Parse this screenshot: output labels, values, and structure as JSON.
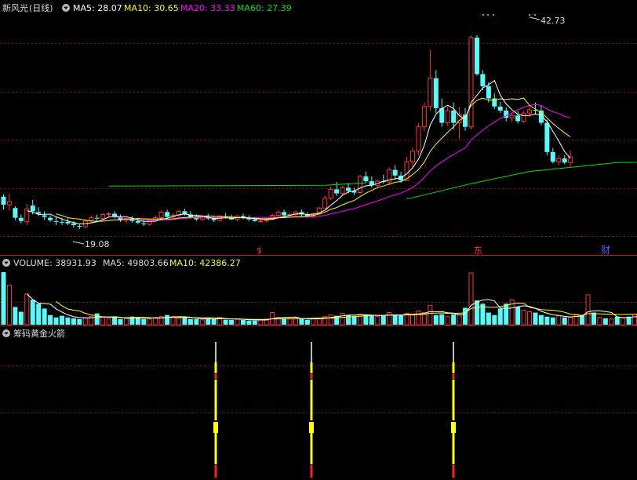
{
  "stock": {
    "name": "新风光",
    "period": "(日线)"
  },
  "colors": {
    "background": "#000000",
    "up": "#ff3333",
    "down": "#54fcfc",
    "ma5": "#ffffff",
    "ma10": "#ffff00",
    "ma20": "#ff00ff",
    "ma60": "#00e000",
    "grid": "#7a1010",
    "divider": "#c01818",
    "rocket_body": "#ffff00",
    "rocket_tip": "#ffffff",
    "rocket_mark": "#ff2020"
  },
  "main_header": {
    "ma5_label": "MA5: 28.07",
    "ma10_label": "MA10: 30.65",
    "ma20_label": "MA20: 33.33",
    "ma60_label": "MA60: 27.39"
  },
  "volume_header": {
    "title": "VOLUME: 38931.93",
    "ma5_label": "MA5: 49803.66",
    "ma10_label": "MA10: 42386.27"
  },
  "indicator_header": {
    "title": "筹码黄金火箭"
  },
  "price_annotations": {
    "high": "42.73",
    "low": "19.08"
  },
  "event_markers": [
    "$",
    "东",
    "财"
  ],
  "chart_data": [
    {
      "type": "candlestick",
      "panel": "price",
      "ylim": [
        16.4,
        45
      ],
      "high_label": "42.73",
      "low_label": "19.08",
      "candles": [
        [
          22.9,
          23.2,
          21.3,
          21.9
        ],
        [
          21.9,
          23.3,
          21.2,
          22.3
        ],
        [
          21.5,
          21.7,
          20.0,
          20.3
        ],
        [
          20.3,
          20.7,
          19.6,
          19.9
        ],
        [
          19.8,
          22.0,
          19.4,
          21.4
        ],
        [
          21.8,
          22.5,
          20.7,
          21.1
        ],
        [
          21.0,
          21.6,
          20.5,
          20.8
        ],
        [
          20.6,
          21.1,
          20.0,
          20.4
        ],
        [
          20.3,
          20.6,
          19.8,
          20.0
        ],
        [
          19.9,
          20.4,
          19.4,
          19.8
        ],
        [
          19.8,
          20.3,
          19.4,
          19.7
        ],
        [
          19.8,
          20.2,
          19.4,
          19.6
        ],
        [
          19.6,
          19.9,
          19.1,
          19.4
        ],
        [
          19.3,
          19.6,
          18.9,
          19.2
        ],
        [
          19.2,
          20.1,
          19.0,
          19.9
        ],
        [
          19.9,
          20.6,
          19.6,
          20.3
        ],
        [
          20.3,
          20.7,
          19.9,
          20.2
        ],
        [
          20.2,
          20.9,
          20.0,
          20.7
        ],
        [
          20.7,
          21.0,
          20.3,
          20.8
        ],
        [
          20.8,
          21.1,
          20.2,
          20.4
        ],
        [
          20.4,
          20.7,
          19.8,
          20.0
        ],
        [
          20.0,
          20.4,
          19.6,
          20.2
        ],
        [
          20.1,
          20.5,
          19.7,
          19.9
        ],
        [
          19.9,
          20.3,
          19.5,
          19.7
        ],
        [
          19.6,
          20.0,
          19.3,
          19.5
        ],
        [
          19.5,
          20.2,
          19.3,
          20.0
        ],
        [
          20.0,
          20.6,
          19.8,
          20.3
        ],
        [
          20.3,
          21.2,
          20.1,
          21.0
        ],
        [
          21.0,
          21.3,
          20.3,
          20.4
        ],
        [
          20.4,
          20.9,
          20.2,
          20.6
        ],
        [
          20.6,
          21.3,
          20.4,
          21.1
        ],
        [
          21.1,
          21.4,
          20.6,
          20.7
        ],
        [
          20.7,
          21.1,
          20.2,
          20.4
        ],
        [
          20.4,
          20.7,
          19.9,
          20.1
        ],
        [
          20.1,
          20.6,
          19.9,
          20.4
        ],
        [
          20.4,
          20.8,
          20.0,
          20.2
        ],
        [
          20.2,
          20.5,
          19.8,
          20.0
        ],
        [
          20.0,
          20.6,
          19.8,
          20.5
        ],
        [
          20.5,
          20.9,
          20.2,
          20.4
        ],
        [
          20.4,
          20.7,
          20.0,
          20.1
        ],
        [
          20.1,
          20.6,
          19.9,
          20.5
        ],
        [
          20.5,
          20.8,
          20.1,
          20.3
        ],
        [
          20.3,
          20.6,
          19.9,
          20.1
        ],
        [
          20.1,
          20.4,
          19.8,
          19.9
        ],
        [
          19.9,
          20.2,
          19.7,
          19.9
        ],
        [
          19.9,
          20.3,
          19.7,
          20.1
        ],
        [
          20.1,
          20.8,
          20.0,
          20.6
        ],
        [
          20.6,
          21.2,
          20.4,
          21.0
        ],
        [
          21.0,
          21.3,
          20.5,
          20.6
        ],
        [
          20.6,
          20.9,
          20.3,
          20.7
        ],
        [
          20.7,
          21.2,
          20.4,
          21.0
        ],
        [
          21.0,
          21.3,
          20.5,
          20.7
        ],
        [
          20.7,
          21.0,
          20.3,
          20.5
        ],
        [
          20.5,
          20.9,
          20.3,
          20.8
        ],
        [
          20.8,
          21.7,
          20.7,
          21.5
        ],
        [
          21.5,
          23.0,
          21.4,
          22.7
        ],
        [
          22.7,
          24.2,
          22.5,
          23.8
        ],
        [
          23.8,
          24.7,
          23.0,
          23.3
        ],
        [
          23.3,
          24.2,
          23.0,
          24.0
        ],
        [
          24.0,
          24.6,
          23.3,
          23.6
        ],
        [
          23.6,
          24.0,
          23.1,
          23.4
        ],
        [
          23.4,
          25.6,
          23.2,
          25.4
        ],
        [
          25.4,
          26.0,
          24.6,
          24.8
        ],
        [
          24.8,
          25.4,
          24.0,
          24.3
        ],
        [
          24.3,
          25.0,
          24.1,
          24.8
        ],
        [
          24.8,
          25.6,
          24.5,
          24.7
        ],
        [
          24.7,
          26.5,
          24.3,
          26.2
        ],
        [
          26.2,
          26.8,
          25.0,
          25.5
        ],
        [
          25.5,
          26.0,
          24.6,
          24.9
        ],
        [
          24.9,
          27.8,
          24.8,
          27.2
        ],
        [
          27.2,
          29.0,
          26.5,
          28.5
        ],
        [
          28.5,
          32.0,
          28.0,
          31.5
        ],
        [
          31.5,
          34.5,
          31.0,
          34.0
        ],
        [
          34.0,
          41.0,
          33.5,
          37.5
        ],
        [
          37.5,
          38.5,
          33.2,
          33.8
        ],
        [
          33.8,
          35.0,
          31.5,
          32.0
        ],
        [
          32.0,
          34.0,
          31.6,
          33.5
        ],
        [
          33.5,
          34.5,
          31.2,
          32.0
        ],
        [
          32.0,
          34.0,
          30.0,
          33.0
        ],
        [
          33.0,
          33.8,
          31.0,
          31.5
        ],
        [
          31.5,
          42.73,
          31.2,
          42.5
        ],
        [
          42.5,
          42.8,
          37.8,
          38.0
        ],
        [
          38.0,
          38.5,
          36.0,
          36.5
        ],
        [
          36.5,
          37.0,
          34.5,
          35.0
        ],
        [
          35.0,
          35.6,
          33.7,
          34.0
        ],
        [
          34.0,
          34.6,
          33.2,
          33.5
        ],
        [
          33.5,
          33.9,
          32.2,
          32.6
        ],
        [
          32.6,
          33.2,
          32.1,
          32.9
        ],
        [
          32.9,
          33.4,
          31.9,
          32.2
        ],
        [
          32.2,
          33.4,
          32.0,
          33.2
        ],
        [
          33.2,
          34.0,
          32.7,
          33.6
        ],
        [
          33.6,
          34.5,
          33.0,
          33.5
        ],
        [
          33.5,
          34.2,
          31.7,
          32.0
        ],
        [
          32.0,
          32.4,
          28.0,
          28.4
        ],
        [
          28.4,
          28.9,
          27.0,
          27.2
        ],
        [
          27.2,
          28.0,
          26.8,
          27.6
        ],
        [
          27.6,
          28.0,
          26.9,
          27.1
        ],
        [
          27.1,
          28.6,
          26.6,
          27.8
        ]
      ],
      "ma60_segments": [
        [
          [
            18,
            24.2
          ],
          [
            55,
            24.3
          ],
          [
            62,
            24.6
          ]
        ],
        [
          [
            69,
            22.6
          ],
          [
            80,
            24.5
          ],
          [
            90,
            26.0
          ],
          [
            105,
            27.1
          ],
          [
            128,
            27.4
          ]
        ]
      ]
    },
    {
      "type": "bar",
      "panel": "volume",
      "ylim": [
        0,
        67000
      ],
      "series": [
        {
          "name": "VOLUME",
          "values": [
            65000,
            49000,
            22000,
            16000,
            38000,
            31000,
            26000,
            20000,
            12000,
            9000,
            11000,
            9000,
            8000,
            7000,
            8000,
            10000,
            14000,
            9000,
            7000,
            9000,
            7000,
            8000,
            10000,
            9000,
            7000,
            7000,
            9000,
            10000,
            12000,
            10000,
            8000,
            9000,
            7000,
            7000,
            6000,
            8000,
            7000,
            9000,
            6000,
            6000,
            7000,
            6000,
            5000,
            5000,
            6000,
            7000,
            15000,
            9000,
            8000,
            7000,
            8000,
            7000,
            6000,
            8000,
            8000,
            10000,
            12000,
            11000,
            14000,
            12000,
            11000,
            13000,
            12000,
            11000,
            10000,
            11000,
            15000,
            12000,
            12000,
            14000,
            12000,
            17000,
            15000,
            24000,
            12000,
            13000,
            10000,
            13000,
            12000,
            21000,
            64000,
            30000,
            26000,
            15000,
            12000,
            20000,
            26000,
            31000,
            22000,
            18000,
            16000,
            15000,
            12000,
            10000,
            9000,
            11000,
            9000,
            9000,
            13000,
            12000,
            37000,
            15000,
            9000,
            8000,
            7000,
            10000,
            9000,
            10000,
            13000,
            8000
          ]
        }
      ]
    }
  ]
}
